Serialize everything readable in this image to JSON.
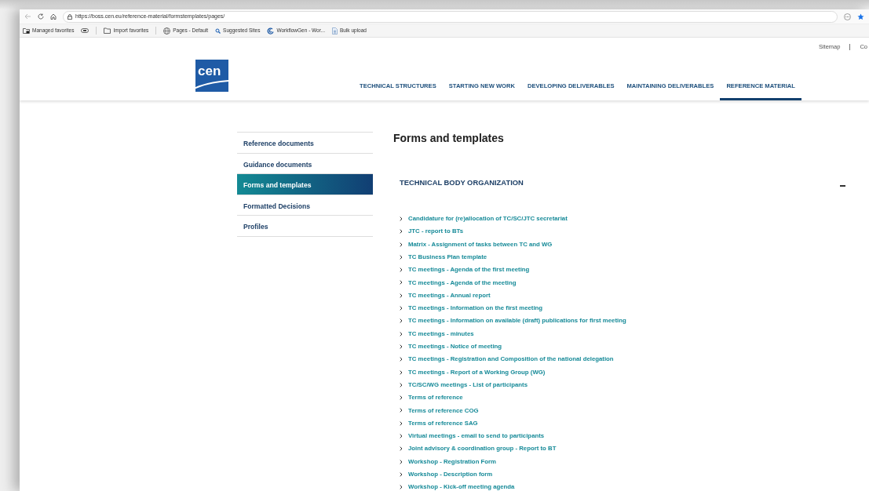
{
  "browser": {
    "url": "https://boss.cen.eu/reference-material/formstemplates/pages/",
    "favorites": [
      {
        "label": "Managed favorites",
        "kind": "folder-lock"
      },
      {
        "kind": "pill"
      },
      {
        "label": "Import favorites",
        "kind": "import"
      },
      {
        "label": "Pages - Default",
        "kind": "globe"
      },
      {
        "label": "Suggested Sites",
        "kind": "search"
      },
      {
        "label": "WorkflowGen - Wor...",
        "kind": "swirl"
      },
      {
        "label": "Bulk upload",
        "kind": "doc"
      }
    ]
  },
  "site": {
    "logo_text": "cen",
    "utility_links": [
      "Sitemap",
      "Co"
    ],
    "nav": [
      {
        "label": "TECHNICAL STRUCTURES",
        "selected": false
      },
      {
        "label": "STARTING NEW WORK",
        "selected": false
      },
      {
        "label": "DEVELOPING DELIVERABLES",
        "selected": false
      },
      {
        "label": "MAINTAINING DELIVERABLES",
        "selected": false
      },
      {
        "label": "REFERENCE MATERIAL",
        "selected": true
      }
    ]
  },
  "sidebar": [
    {
      "label": "Reference documents",
      "selected": false
    },
    {
      "label": "Guidance documents",
      "selected": false
    },
    {
      "label": "Forms and templates",
      "selected": true
    },
    {
      "label": "Formatted Decisions",
      "selected": false
    },
    {
      "label": "Profiles",
      "selected": false
    }
  ],
  "page": {
    "title": "Forms and templates",
    "section": {
      "title": "TECHNICAL BODY ORGANIZATION",
      "expanded": true,
      "items": [
        "Candidature for (re)allocation of TC/SC/JTC secretariat",
        "JTC - report to BTs",
        "Matrix - Assignment of tasks between TC and WG",
        "TC Business Plan template",
        "TC meetings - Agenda of the first meeting",
        "TC meetings - Agenda of the meeting",
        "TC meetings - Annual report",
        "TC meetings - Information on the first meeting",
        "TC meetings - Information on available (draft) publications for first meeting",
        "TC meetings - minutes",
        "TC meetings - Notice of meeting",
        "TC meetings - Registration and Composition of the national delegation",
        "TC meetings - Report of a Working Group (WG)",
        "TC/SC/WG meetings - List of participants",
        "Terms of reference",
        "Terms of reference COG",
        "Terms of reference SAG",
        "Virtual meetings - email to send to participants",
        "Joint advisory & coordination group - Report to BT",
        "Workshop - Registration Form",
        "Workshop - Description form",
        "Workshop - Kick-off meeting agenda"
      ]
    }
  }
}
